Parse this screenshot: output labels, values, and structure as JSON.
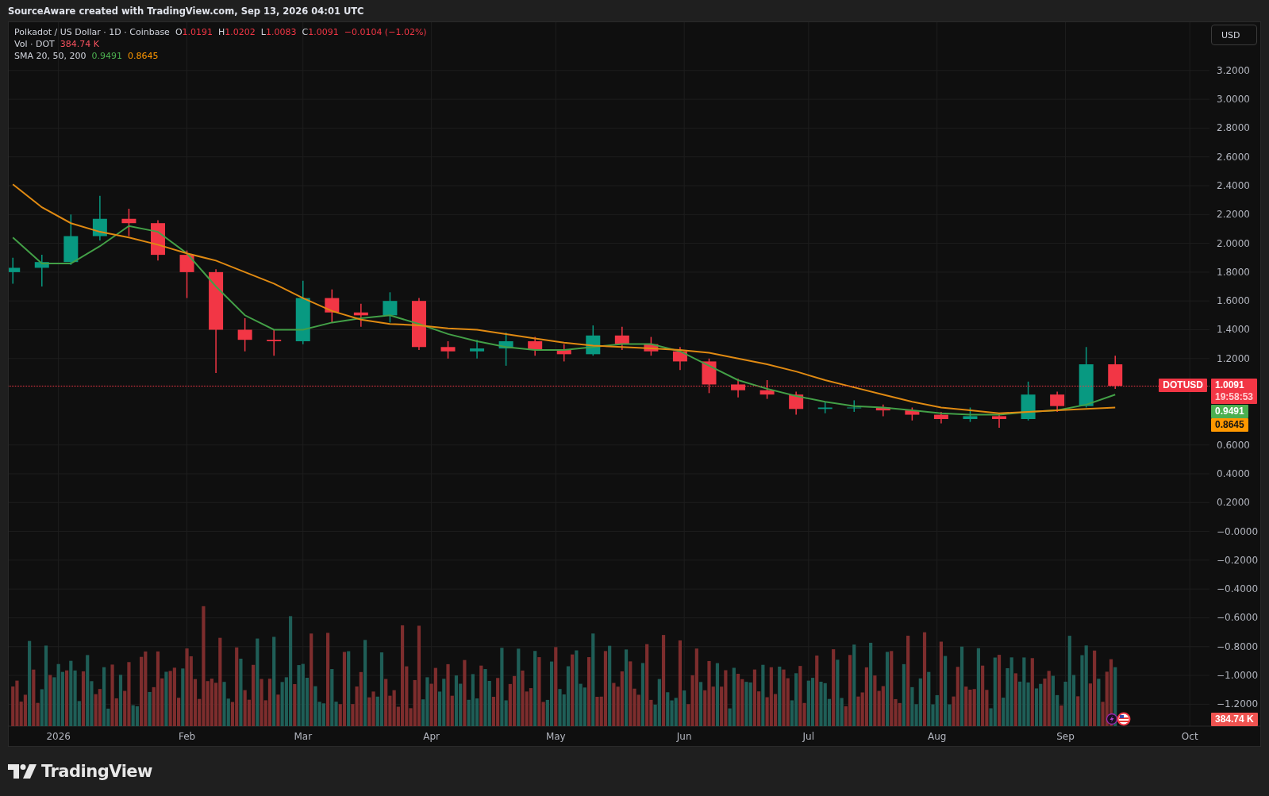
{
  "header": {
    "text": "SourceAware created with TradingView.com, Sep 13, 2026 04:01 UTC"
  },
  "chart": {
    "legend": {
      "symbol": "Polkadot / US Dollar · 1D · Coinbase",
      "ohlc": [
        {
          "label": "O",
          "value": "1.0191"
        },
        {
          "label": "H",
          "value": "1.0202"
        },
        {
          "label": "L",
          "value": "1.0083"
        },
        {
          "label": "C",
          "value": "1.0091"
        }
      ],
      "change": "−0.0104 (−1.02%)",
      "volume": {
        "label": "Vol · DOT",
        "value": "384.74 K"
      },
      "sma": {
        "label": "SMA 20, 50, 200",
        "values": [
          {
            "value": "0.9491",
            "color": "#4caf50"
          },
          {
            "value": "0.8645",
            "color": "#ff9800"
          }
        ]
      }
    },
    "currency_button": {
      "label": "USD"
    },
    "price_tags": [
      {
        "kind": "price",
        "symbol": "DOTUSD",
        "value": "1.0091",
        "countdown": "19:58:53",
        "color": "#f23645"
      },
      {
        "kind": "indicator",
        "value": "0.9491",
        "color": "#4caf50"
      },
      {
        "kind": "indicator",
        "value": "0.8645",
        "color": "#ff9800"
      },
      {
        "kind": "volume",
        "value": "384.74 K",
        "color": "#ef5350"
      }
    ],
    "chart_data": {
      "type": "candlestick",
      "grid": true,
      "x": [
        "2025-12-21",
        "2025-12-28",
        "2026-01-04",
        "2026-01-11",
        "2026-01-18",
        "2026-01-25",
        "2026-02-01",
        "2026-02-08",
        "2026-02-15",
        "2026-02-22",
        "2026-03-01",
        "2026-03-08",
        "2026-03-15",
        "2026-03-22",
        "2026-03-29",
        "2026-04-05",
        "2026-04-12",
        "2026-04-19",
        "2026-04-26",
        "2026-05-03",
        "2026-05-10",
        "2026-05-17",
        "2026-05-24",
        "2026-05-31",
        "2026-06-07",
        "2026-06-14",
        "2026-06-21",
        "2026-06-28",
        "2026-07-05",
        "2026-07-12",
        "2026-07-19",
        "2026-07-26",
        "2026-08-02",
        "2026-08-09",
        "2026-08-16",
        "2026-08-23",
        "2026-08-30",
        "2026-09-06",
        "2026-09-13"
      ],
      "ohlc": [
        [
          1.8,
          1.9,
          1.72,
          1.83
        ],
        [
          1.83,
          1.92,
          1.7,
          1.87
        ],
        [
          1.87,
          2.2,
          1.85,
          2.05
        ],
        [
          2.05,
          2.33,
          2.02,
          2.17
        ],
        [
          2.17,
          2.24,
          2.05,
          2.14
        ],
        [
          2.14,
          2.16,
          1.88,
          1.92
        ],
        [
          1.92,
          1.95,
          1.62,
          1.8
        ],
        [
          1.8,
          1.82,
          1.1,
          1.4
        ],
        [
          1.4,
          1.48,
          1.25,
          1.33
        ],
        [
          1.33,
          1.4,
          1.22,
          1.32
        ],
        [
          1.32,
          1.74,
          1.3,
          1.62
        ],
        [
          1.62,
          1.68,
          1.45,
          1.52
        ],
        [
          1.52,
          1.58,
          1.42,
          1.5
        ],
        [
          1.5,
          1.66,
          1.45,
          1.6
        ],
        [
          1.6,
          1.62,
          1.26,
          1.28
        ],
        [
          1.28,
          1.32,
          1.2,
          1.25
        ],
        [
          1.25,
          1.33,
          1.2,
          1.27
        ],
        [
          1.27,
          1.38,
          1.15,
          1.32
        ],
        [
          1.32,
          1.35,
          1.22,
          1.26
        ],
        [
          1.26,
          1.3,
          1.18,
          1.23
        ],
        [
          1.23,
          1.43,
          1.22,
          1.36
        ],
        [
          1.36,
          1.42,
          1.26,
          1.3
        ],
        [
          1.3,
          1.35,
          1.22,
          1.25
        ],
        [
          1.25,
          1.28,
          1.12,
          1.18
        ],
        [
          1.18,
          1.2,
          0.96,
          1.02
        ],
        [
          1.02,
          1.06,
          0.93,
          0.98
        ],
        [
          0.98,
          1.05,
          0.92,
          0.95
        ],
        [
          0.95,
          0.97,
          0.81,
          0.85
        ],
        [
          0.85,
          0.9,
          0.82,
          0.86
        ],
        [
          0.86,
          0.91,
          0.83,
          0.86
        ],
        [
          0.86,
          0.88,
          0.8,
          0.84
        ],
        [
          0.84,
          0.86,
          0.77,
          0.81
        ],
        [
          0.81,
          0.83,
          0.75,
          0.78
        ],
        [
          0.78,
          0.86,
          0.76,
          0.8
        ],
        [
          0.8,
          0.82,
          0.72,
          0.78
        ],
        [
          0.78,
          1.04,
          0.77,
          0.95
        ],
        [
          0.95,
          0.97,
          0.83,
          0.87
        ],
        [
          0.87,
          1.28,
          0.86,
          1.16
        ],
        [
          1.16,
          1.22,
          0.99,
          1.01
        ]
      ],
      "xlim": [
        "2025-12-20",
        "2026-10-18"
      ],
      "ylim": [
        -1.49,
        3.535
      ],
      "xticks": [
        {
          "value": "2026-01-01",
          "label": "2026"
        },
        {
          "value": "2026-02-01",
          "label": "Feb"
        },
        {
          "value": "2026-03-01",
          "label": "Mar"
        },
        {
          "value": "2026-04-01",
          "label": "Apr"
        },
        {
          "value": "2026-05-01",
          "label": "May"
        },
        {
          "value": "2026-06-01",
          "label": "Jun"
        },
        {
          "value": "2026-07-01",
          "label": "Jul"
        },
        {
          "value": "2026-08-01",
          "label": "Aug"
        },
        {
          "value": "2026-09-01",
          "label": "Sep"
        },
        {
          "value": "2026-10-01",
          "label": "Oct"
        }
      ],
      "yticks": [
        {
          "value": 3.2,
          "label": "3.2000"
        },
        {
          "value": 3.0,
          "label": "3.0000"
        },
        {
          "value": 2.8,
          "label": "2.8000"
        },
        {
          "value": 2.6,
          "label": "2.6000"
        },
        {
          "value": 2.4,
          "label": "2.4000"
        },
        {
          "value": 2.2,
          "label": "2.2000"
        },
        {
          "value": 2.0,
          "label": "2.0000"
        },
        {
          "value": 1.8,
          "label": "1.8000"
        },
        {
          "value": 1.6,
          "label": "1.6000"
        },
        {
          "value": 1.4,
          "label": "1.4000"
        },
        {
          "value": 1.2,
          "label": "1.2000"
        },
        {
          "value": 0.6,
          "label": "0.6000"
        },
        {
          "value": 0.4,
          "label": "0.4000"
        },
        {
          "value": 0.2,
          "label": "0.2000"
        },
        {
          "value": 0,
          "label": "−0.0000"
        },
        {
          "value": -0.2,
          "label": "−0.2000"
        },
        {
          "value": -0.4,
          "label": "−0.4000"
        },
        {
          "value": -0.6,
          "label": "−0.6000"
        },
        {
          "value": -0.8,
          "label": "−0.8000"
        },
        {
          "value": -1.0,
          "label": "−1.0000"
        },
        {
          "value": -1.2,
          "label": "−1.2000"
        }
      ]
    },
    "indicator_overlay": {
      "chart_data": {
        "type": "line",
        "x": [
          "2025-12-21",
          "2025-12-28",
          "2026-01-04",
          "2026-01-11",
          "2026-01-18",
          "2026-01-25",
          "2026-02-01",
          "2026-02-08",
          "2026-02-15",
          "2026-02-22",
          "2026-03-01",
          "2026-03-08",
          "2026-03-15",
          "2026-03-22",
          "2026-03-29",
          "2026-04-05",
          "2026-04-12",
          "2026-04-19",
          "2026-04-26",
          "2026-05-03",
          "2026-05-10",
          "2026-05-17",
          "2026-05-24",
          "2026-05-31",
          "2026-06-07",
          "2026-06-14",
          "2026-06-21",
          "2026-06-28",
          "2026-07-05",
          "2026-07-12",
          "2026-07-19",
          "2026-07-26",
          "2026-08-02",
          "2026-08-09",
          "2026-08-16",
          "2026-08-23",
          "2026-08-30",
          "2026-09-06",
          "2026-09-13"
        ],
        "series": [
          {
            "color": "#43a047",
            "values": [
              2.04,
              1.86,
              1.86,
              1.98,
              2.12,
              2.08,
              1.93,
              1.7,
              1.5,
              1.4,
              1.4,
              1.45,
              1.48,
              1.5,
              1.44,
              1.37,
              1.32,
              1.28,
              1.26,
              1.26,
              1.28,
              1.3,
              1.3,
              1.25,
              1.15,
              1.05,
              0.99,
              0.94,
              0.9,
              0.87,
              0.86,
              0.84,
              0.82,
              0.81,
              0.81,
              0.83,
              0.84,
              0.88,
              0.95
            ]
          },
          {
            "color": "#e08a12",
            "values": [
              2.41,
              2.25,
              2.14,
              2.08,
              2.04,
              1.99,
              1.93,
              1.88,
              1.8,
              1.72,
              1.62,
              1.53,
              1.47,
              1.44,
              1.43,
              1.41,
              1.4,
              1.37,
              1.34,
              1.31,
              1.29,
              1.28,
              1.27,
              1.26,
              1.24,
              1.2,
              1.16,
              1.11,
              1.05,
              1.0,
              0.95,
              0.9,
              0.86,
              0.84,
              0.82,
              0.83,
              0.84,
              0.85,
              0.86
            ]
          }
        ],
        "xlim": [
          "2025-12-20",
          "2026-10-18"
        ],
        "ylim": [
          -1.49,
          3.535
        ]
      }
    }
  },
  "footer": {
    "brand": "TradingView"
  }
}
